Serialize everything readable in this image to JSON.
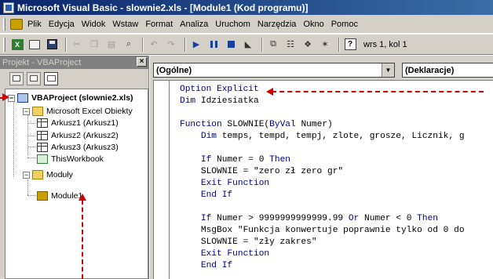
{
  "window": {
    "title": "Microsoft Visual Basic - slownie2.xls - [Module1 (Kod programu)]"
  },
  "menu": [
    "Plik",
    "Edycja",
    "Widok",
    "Wstaw",
    "Format",
    "Analiza",
    "Uruchom",
    "Narzędzia",
    "Okno",
    "Pomoc"
  ],
  "toolbar": {
    "position": "wrs 1, kol 1"
  },
  "project": {
    "title": "Projekt - VBAProject",
    "close": "×",
    "root": "VBAProject (slownie2.xls)",
    "excel_folder": "Microsoft Excel Obiekty",
    "sheets": [
      "Arkusz1 (Arkusz1)",
      "Arkusz2 (Arkusz2)",
      "Arkusz3 (Arkusz3)"
    ],
    "workbook": "ThisWorkbook",
    "modules_folder": "Moduły",
    "module": "Module1",
    "expand": "−"
  },
  "code": {
    "object_combo": "(Ogólne)",
    "proc_combo": "(Deklaracje)",
    "lines": [
      {
        "kw": "Option Explicit",
        "rest": ""
      },
      {
        "kw": "Dim",
        "rest": " Idziesiatka"
      },
      {
        "kw": "",
        "rest": ""
      },
      {
        "kw": "Function",
        "rest": " SLOWNIE(",
        "kw2": "ByVal",
        "rest2": " Numer)"
      },
      {
        "kw": "    Dim",
        "rest": " temps, tempd, tempj, zlote, grosze, Licznik, g"
      },
      {
        "kw": "",
        "rest": ""
      },
      {
        "kw": "    If",
        "rest": " Numer = 0 ",
        "kw2": "Then",
        "rest2": ""
      },
      {
        "kw": "",
        "rest": "    SLOWNIE = \"zero zł zero gr\""
      },
      {
        "kw": "    Exit Function",
        "rest": ""
      },
      {
        "kw": "    End If",
        "rest": ""
      },
      {
        "kw": "",
        "rest": ""
      },
      {
        "kw": "    If",
        "rest": " Numer > 9999999999999.99 ",
        "kw2": "Or",
        "rest2": " Numer < 0 ",
        "kw3": "Then"
      },
      {
        "kw": "",
        "rest": "    MsgBox \"Funkcja konwertuje poprawnie tylko od 0 do"
      },
      {
        "kw": "",
        "rest": "    SLOWNIE = \"zły zakres\""
      },
      {
        "kw": "    Exit Function",
        "rest": ""
      },
      {
        "kw": "    End If",
        "rest": ""
      }
    ]
  },
  "colors": {
    "accent": "#d00000",
    "keyword": "#00008b",
    "titlebar": "#0a246a"
  }
}
